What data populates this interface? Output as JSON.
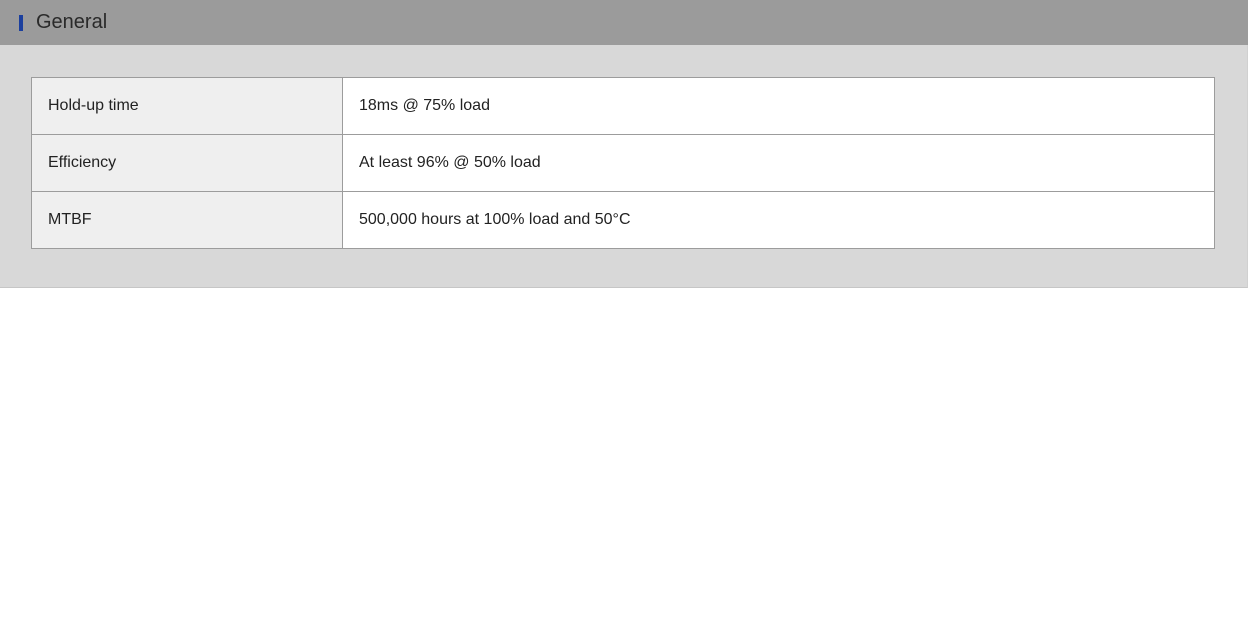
{
  "section": {
    "title": "General",
    "accent_color": "#1b3f9e"
  },
  "specs": [
    {
      "label": "Hold-up time",
      "value": "18ms @ 75% load"
    },
    {
      "label": "Efficiency",
      "value": "At least 96% @ 50% load"
    },
    {
      "label": "MTBF",
      "value": "500,000 hours at 100% load and 50°C"
    }
  ]
}
